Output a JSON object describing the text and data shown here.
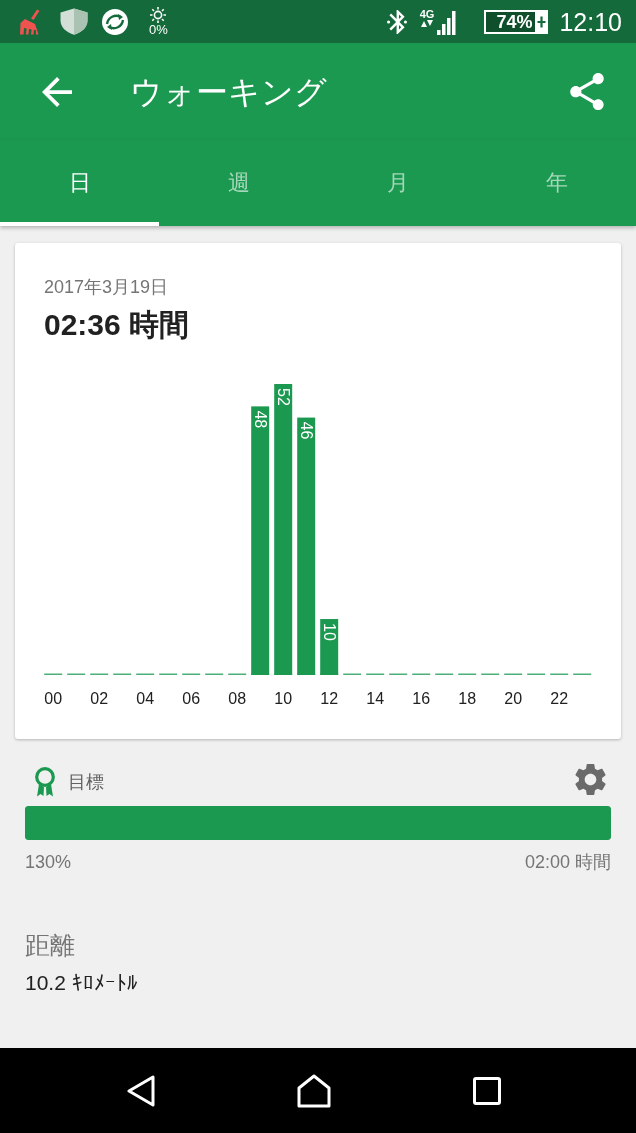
{
  "status_bar": {
    "brightness": "0%",
    "network": "4G",
    "battery": "74%",
    "time": "12:10"
  },
  "app_bar": {
    "title": "ウォーキング"
  },
  "tabs": [
    {
      "label": "日",
      "selected": true
    },
    {
      "label": "週",
      "selected": false
    },
    {
      "label": "月",
      "selected": false
    },
    {
      "label": "年",
      "selected": false
    }
  ],
  "summary_card": {
    "date": "2017年3月19日",
    "total": "02:36 時間",
    "chart_data": {
      "type": "bar",
      "x": [
        0,
        1,
        2,
        3,
        4,
        5,
        6,
        7,
        8,
        9,
        10,
        11,
        12,
        13,
        14,
        15,
        16,
        17,
        18,
        19,
        20,
        21,
        22,
        23
      ],
      "values": [
        0,
        0,
        0,
        0,
        0,
        0,
        0,
        0,
        0,
        48,
        52,
        46,
        10,
        0,
        0,
        0,
        0,
        0,
        0,
        0,
        0,
        0,
        0,
        0
      ],
      "xlim": [
        -0.4,
        23.6
      ],
      "xticks": [
        {
          "value": 0,
          "label": "00"
        },
        {
          "value": 2,
          "label": "02"
        },
        {
          "value": 4,
          "label": "04"
        },
        {
          "value": 6,
          "label": "06"
        },
        {
          "value": 8,
          "label": "08"
        },
        {
          "value": 10,
          "label": "10"
        },
        {
          "value": 12,
          "label": "12"
        },
        {
          "value": 14,
          "label": "14"
        },
        {
          "value": 16,
          "label": "16"
        },
        {
          "value": 18,
          "label": "18"
        },
        {
          "value": 20,
          "label": "20"
        },
        {
          "value": 22,
          "label": "22"
        }
      ],
      "value_labels": [
        null,
        null,
        null,
        null,
        null,
        null,
        null,
        null,
        null,
        "48",
        "52",
        "46",
        "10",
        null,
        null,
        null,
        null,
        null,
        null,
        null,
        null,
        null,
        null,
        null
      ]
    }
  },
  "goal": {
    "label": "目標",
    "level": 1,
    "percent": "130%",
    "target": "02:00 時間"
  },
  "distance": {
    "label": "距離",
    "value": "10.2 ｷﾛﾒｰﾄﾙ"
  }
}
